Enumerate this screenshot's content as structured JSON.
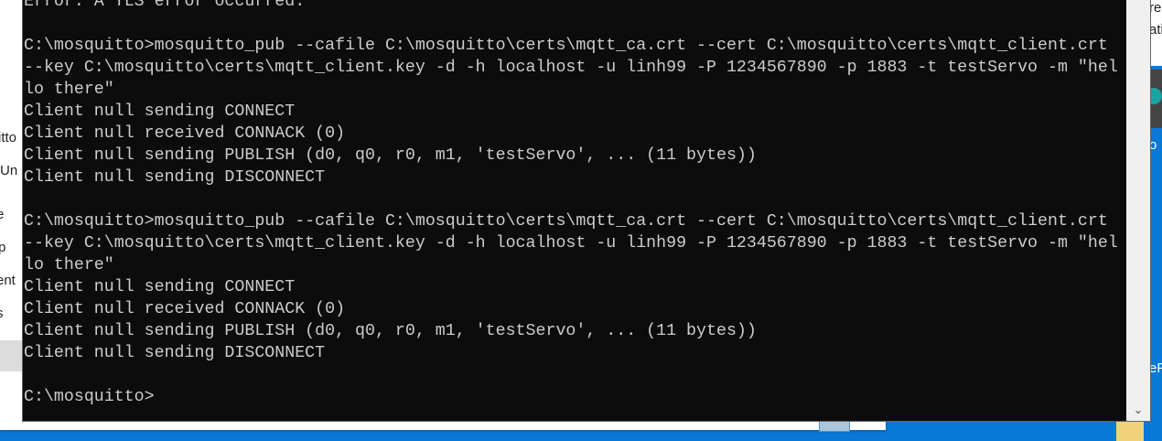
{
  "background_window": {
    "fragments": [
      "itto",
      "Un",
      "e",
      "p",
      "ent",
      "s"
    ]
  },
  "right_fragments": [
    "re",
    "ati",
    "o",
    "eFa"
  ],
  "terminal": {
    "lines": [
      "Error: A TLS error occurred.",
      "",
      "C:\\mosquitto>mosquitto_pub --cafile C:\\mosquitto\\certs\\mqtt_ca.crt --cert C:\\mosquitto\\certs\\mqtt_client.crt",
      "--key C:\\mosquitto\\certs\\mqtt_client.key -d -h localhost -u linh99 -P 1234567890 -p 1883 -t testServo -m \"hel",
      "lo there\"",
      "Client null sending CONNECT",
      "Client null received CONNACK (0)",
      "Client null sending PUBLISH (d0, q0, r0, m1, 'testServo', ... (11 bytes))",
      "Client null sending DISCONNECT",
      "",
      "C:\\mosquitto>mosquitto_pub --cafile C:\\mosquitto\\certs\\mqtt_ca.crt --cert C:\\mosquitto\\certs\\mqtt_client.crt",
      "--key C:\\mosquitto\\certs\\mqtt_client.key -d -h localhost -u linh99 -P 1234567890 -p 1883 -t testServo -m \"hel",
      "lo there\"",
      "Client null sending CONNECT",
      "Client null received CONNACK (0)",
      "Client null sending PUBLISH (d0, q0, r0, m1, 'testServo', ... (11 bytes))",
      "Client null sending DISCONNECT",
      "",
      "C:\\mosquitto>"
    ]
  },
  "scrollbar": {
    "down_icon": "chevron-down-icon"
  }
}
